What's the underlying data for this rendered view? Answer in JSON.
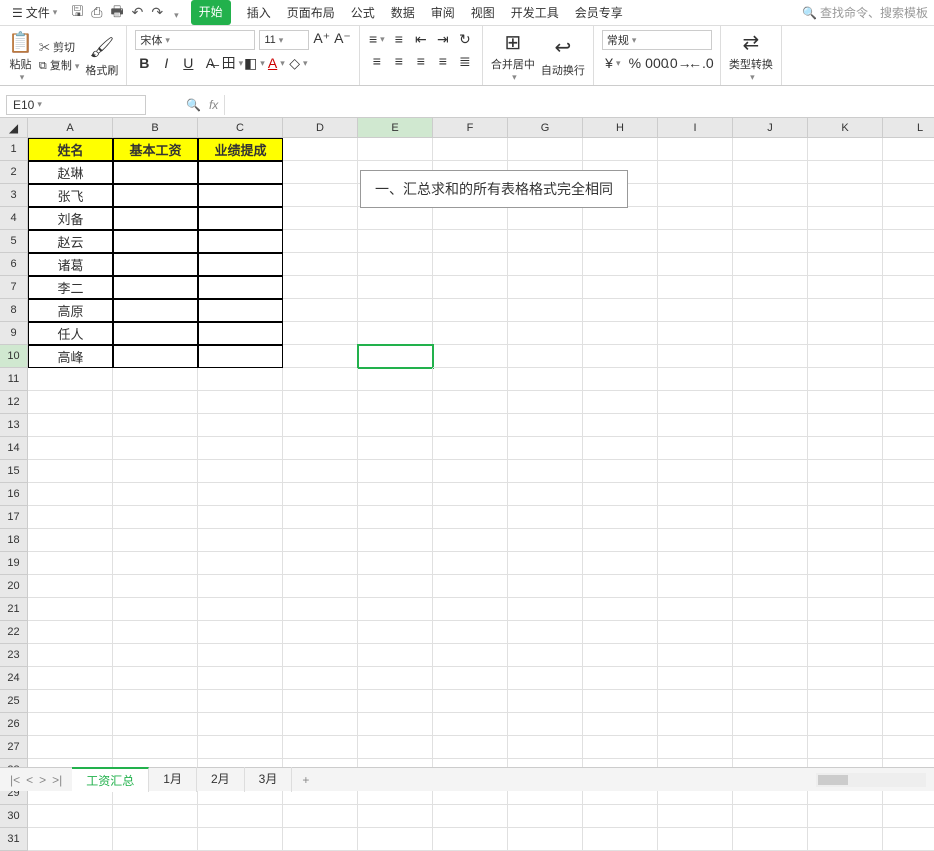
{
  "menu": {
    "file": "文件",
    "tabs": [
      "开始",
      "插入",
      "页面布局",
      "公式",
      "数据",
      "审阅",
      "视图",
      "开发工具",
      "会员专享"
    ],
    "active_tab": 0,
    "search_placeholder": "查找命令、搜索模板"
  },
  "ribbon": {
    "paste": "粘贴",
    "cut": "剪切",
    "copy": "复制",
    "format_painter": "格式刷",
    "font_name": "宋体",
    "font_size": "11",
    "merge": "合并居中",
    "wrap": "自动换行",
    "number_format": "常规",
    "type_convert": "类型转换"
  },
  "formula_bar": {
    "name_box": "E10",
    "fx": "fx"
  },
  "columns": [
    "A",
    "B",
    "C",
    "D",
    "E",
    "F",
    "G",
    "H",
    "I",
    "J",
    "K",
    "L"
  ],
  "row_count": 31,
  "active_cell": {
    "row": 10,
    "col": "E"
  },
  "table": {
    "headers": [
      "姓名",
      "基本工资",
      "业绩提成"
    ],
    "rows": [
      "赵琳",
      "张飞",
      "刘备",
      "赵云",
      "诸葛",
      "李二",
      "高原",
      "任人",
      "高峰"
    ]
  },
  "callout": "一、汇总求和的所有表格格式完全相同",
  "sheets": {
    "active": "工资汇总",
    "list": [
      "工资汇总",
      "1月",
      "2月",
      "3月"
    ]
  }
}
